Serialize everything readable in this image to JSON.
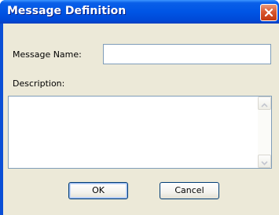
{
  "window": {
    "title": "Message Definition"
  },
  "form": {
    "name_label": "Message Name:",
    "name_value": "",
    "description_label": "Description:",
    "description_value": ""
  },
  "buttons": {
    "ok_label": "OK",
    "cancel_label": "Cancel"
  },
  "icons": {
    "close": "close-icon",
    "scroll_up": "chevron-up-icon",
    "scroll_down": "chevron-down-icon"
  },
  "colors": {
    "titlebar": "#0055e5",
    "close_button": "#d9572f",
    "dialog_background": "#ece9d8",
    "input_border": "#7f9db9",
    "button_border": "#003c74"
  }
}
